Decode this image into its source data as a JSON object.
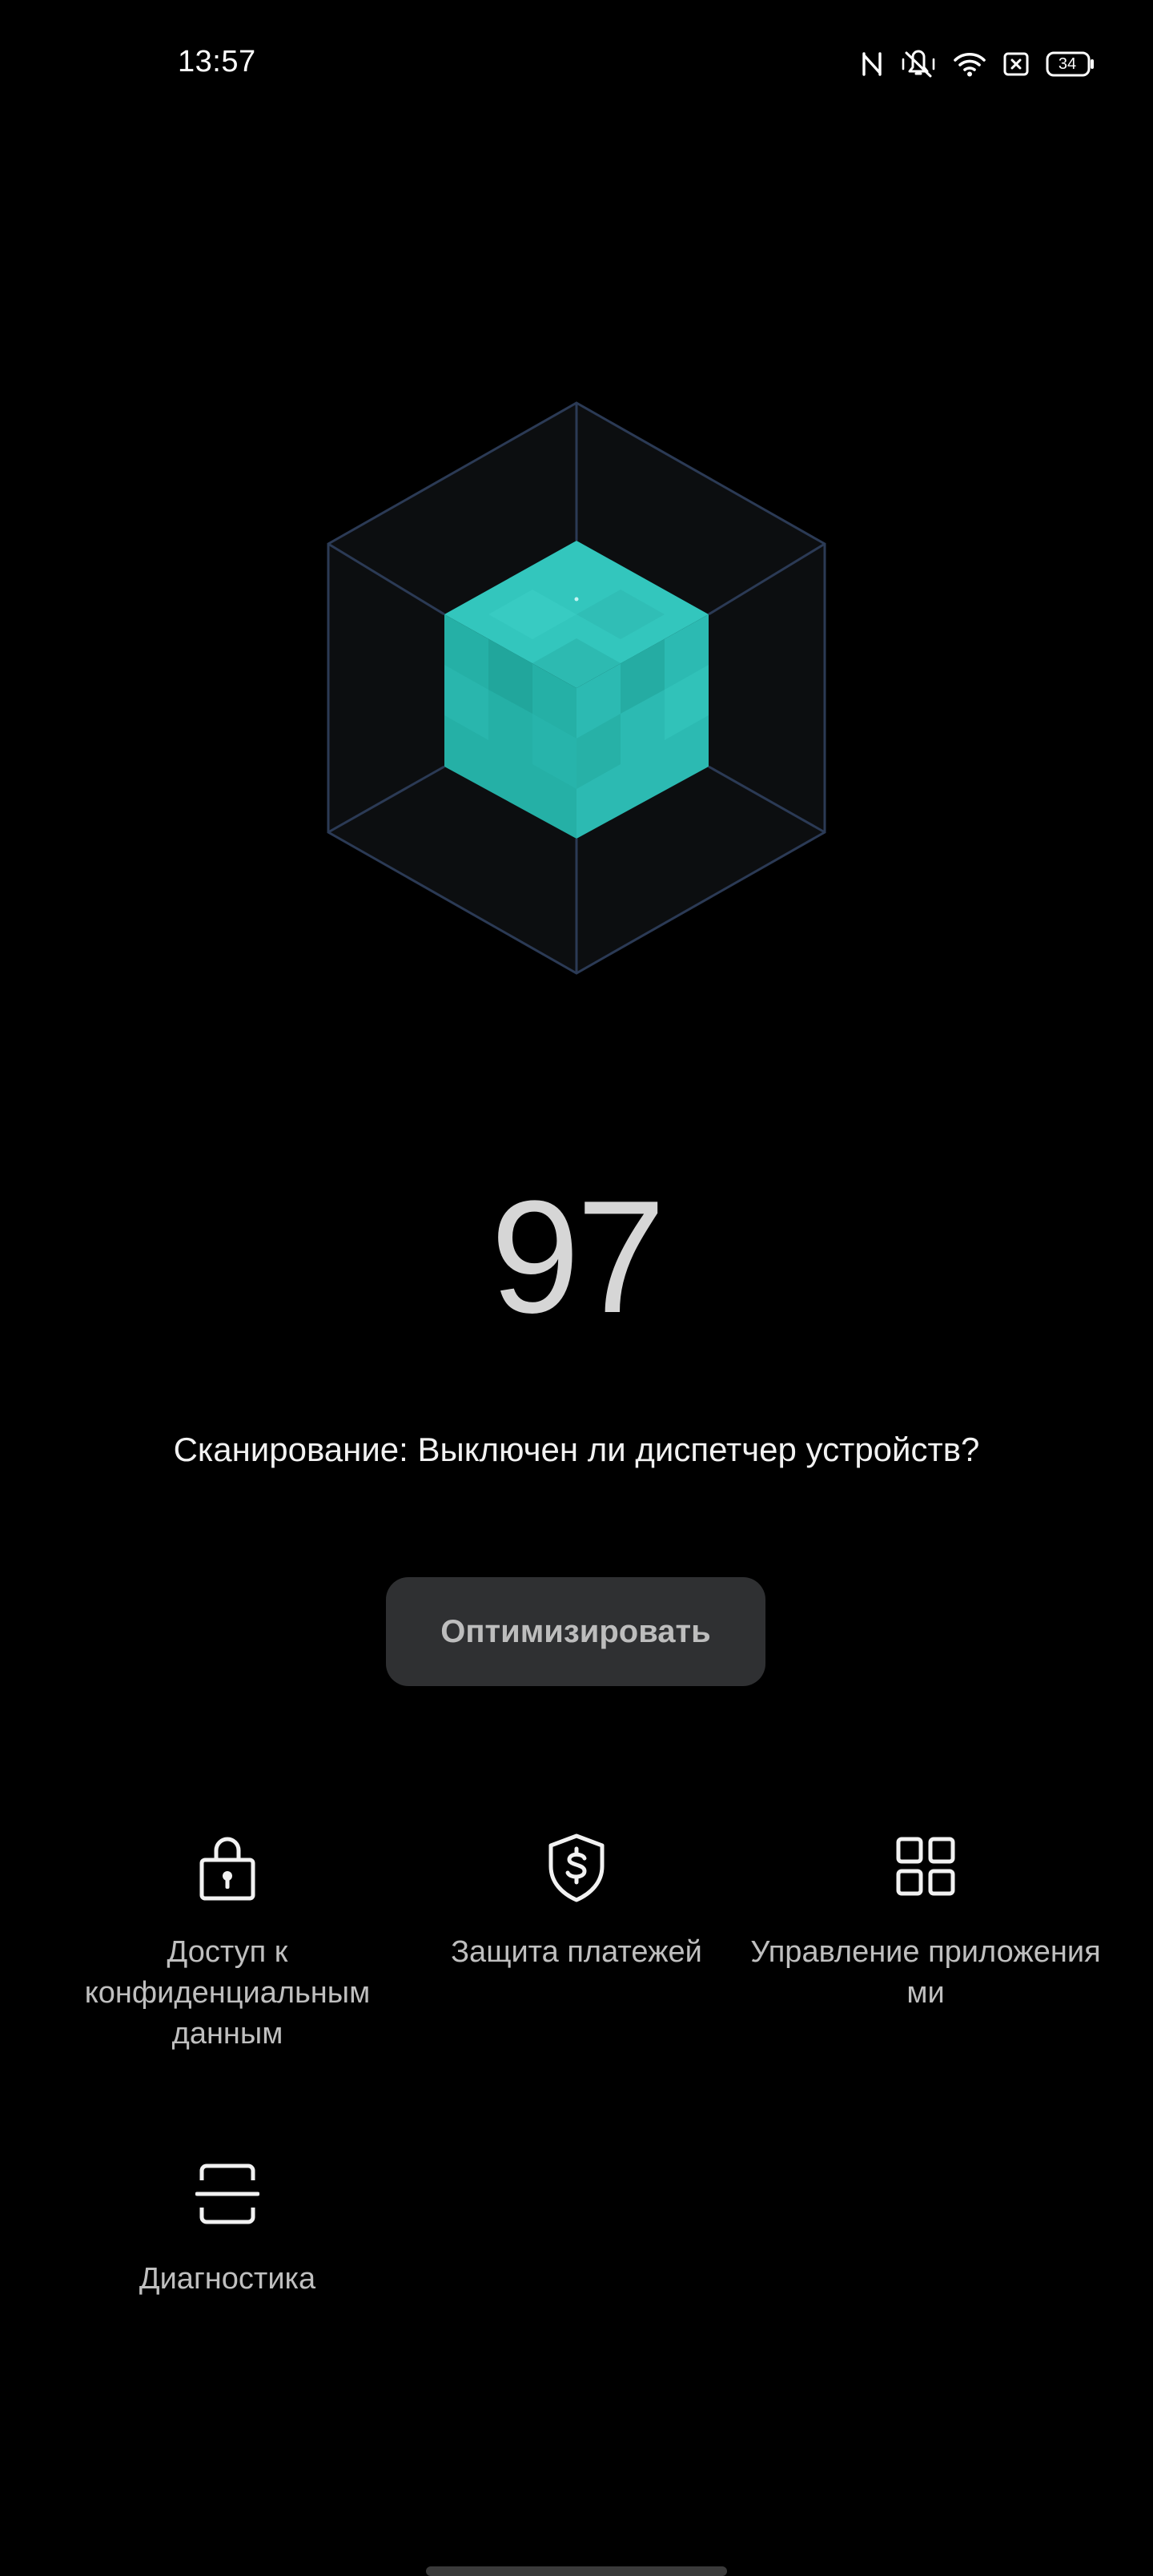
{
  "status_bar": {
    "time": "13:57",
    "battery_level": "34",
    "icons": [
      "nfc-icon",
      "mute-vibrate-icon",
      "wifi-icon",
      "sim-error-icon",
      "battery-icon"
    ]
  },
  "hero": {
    "icon": "security-cube-icon",
    "accent_color": "#2ec4b6",
    "frame_color": "#2b3a55"
  },
  "score": {
    "value": "97"
  },
  "scan": {
    "text": "Сканирование: Выключен ли диспетчер устройств?"
  },
  "optimize_button": {
    "label": "Оптимизировать"
  },
  "features": [
    {
      "icon": "lock-icon",
      "label_lines": [
        "Доступ к",
        "конфиденциальным",
        "данным"
      ]
    },
    {
      "icon": "shield-dollar-icon",
      "label_lines": [
        "Защита платежей"
      ]
    },
    {
      "icon": "grid-apps-icon",
      "label_lines": [
        "Управление приложения",
        "ми"
      ]
    },
    {
      "icon": "scan-frame-icon",
      "label_lines": [
        "Диагностика"
      ]
    }
  ]
}
